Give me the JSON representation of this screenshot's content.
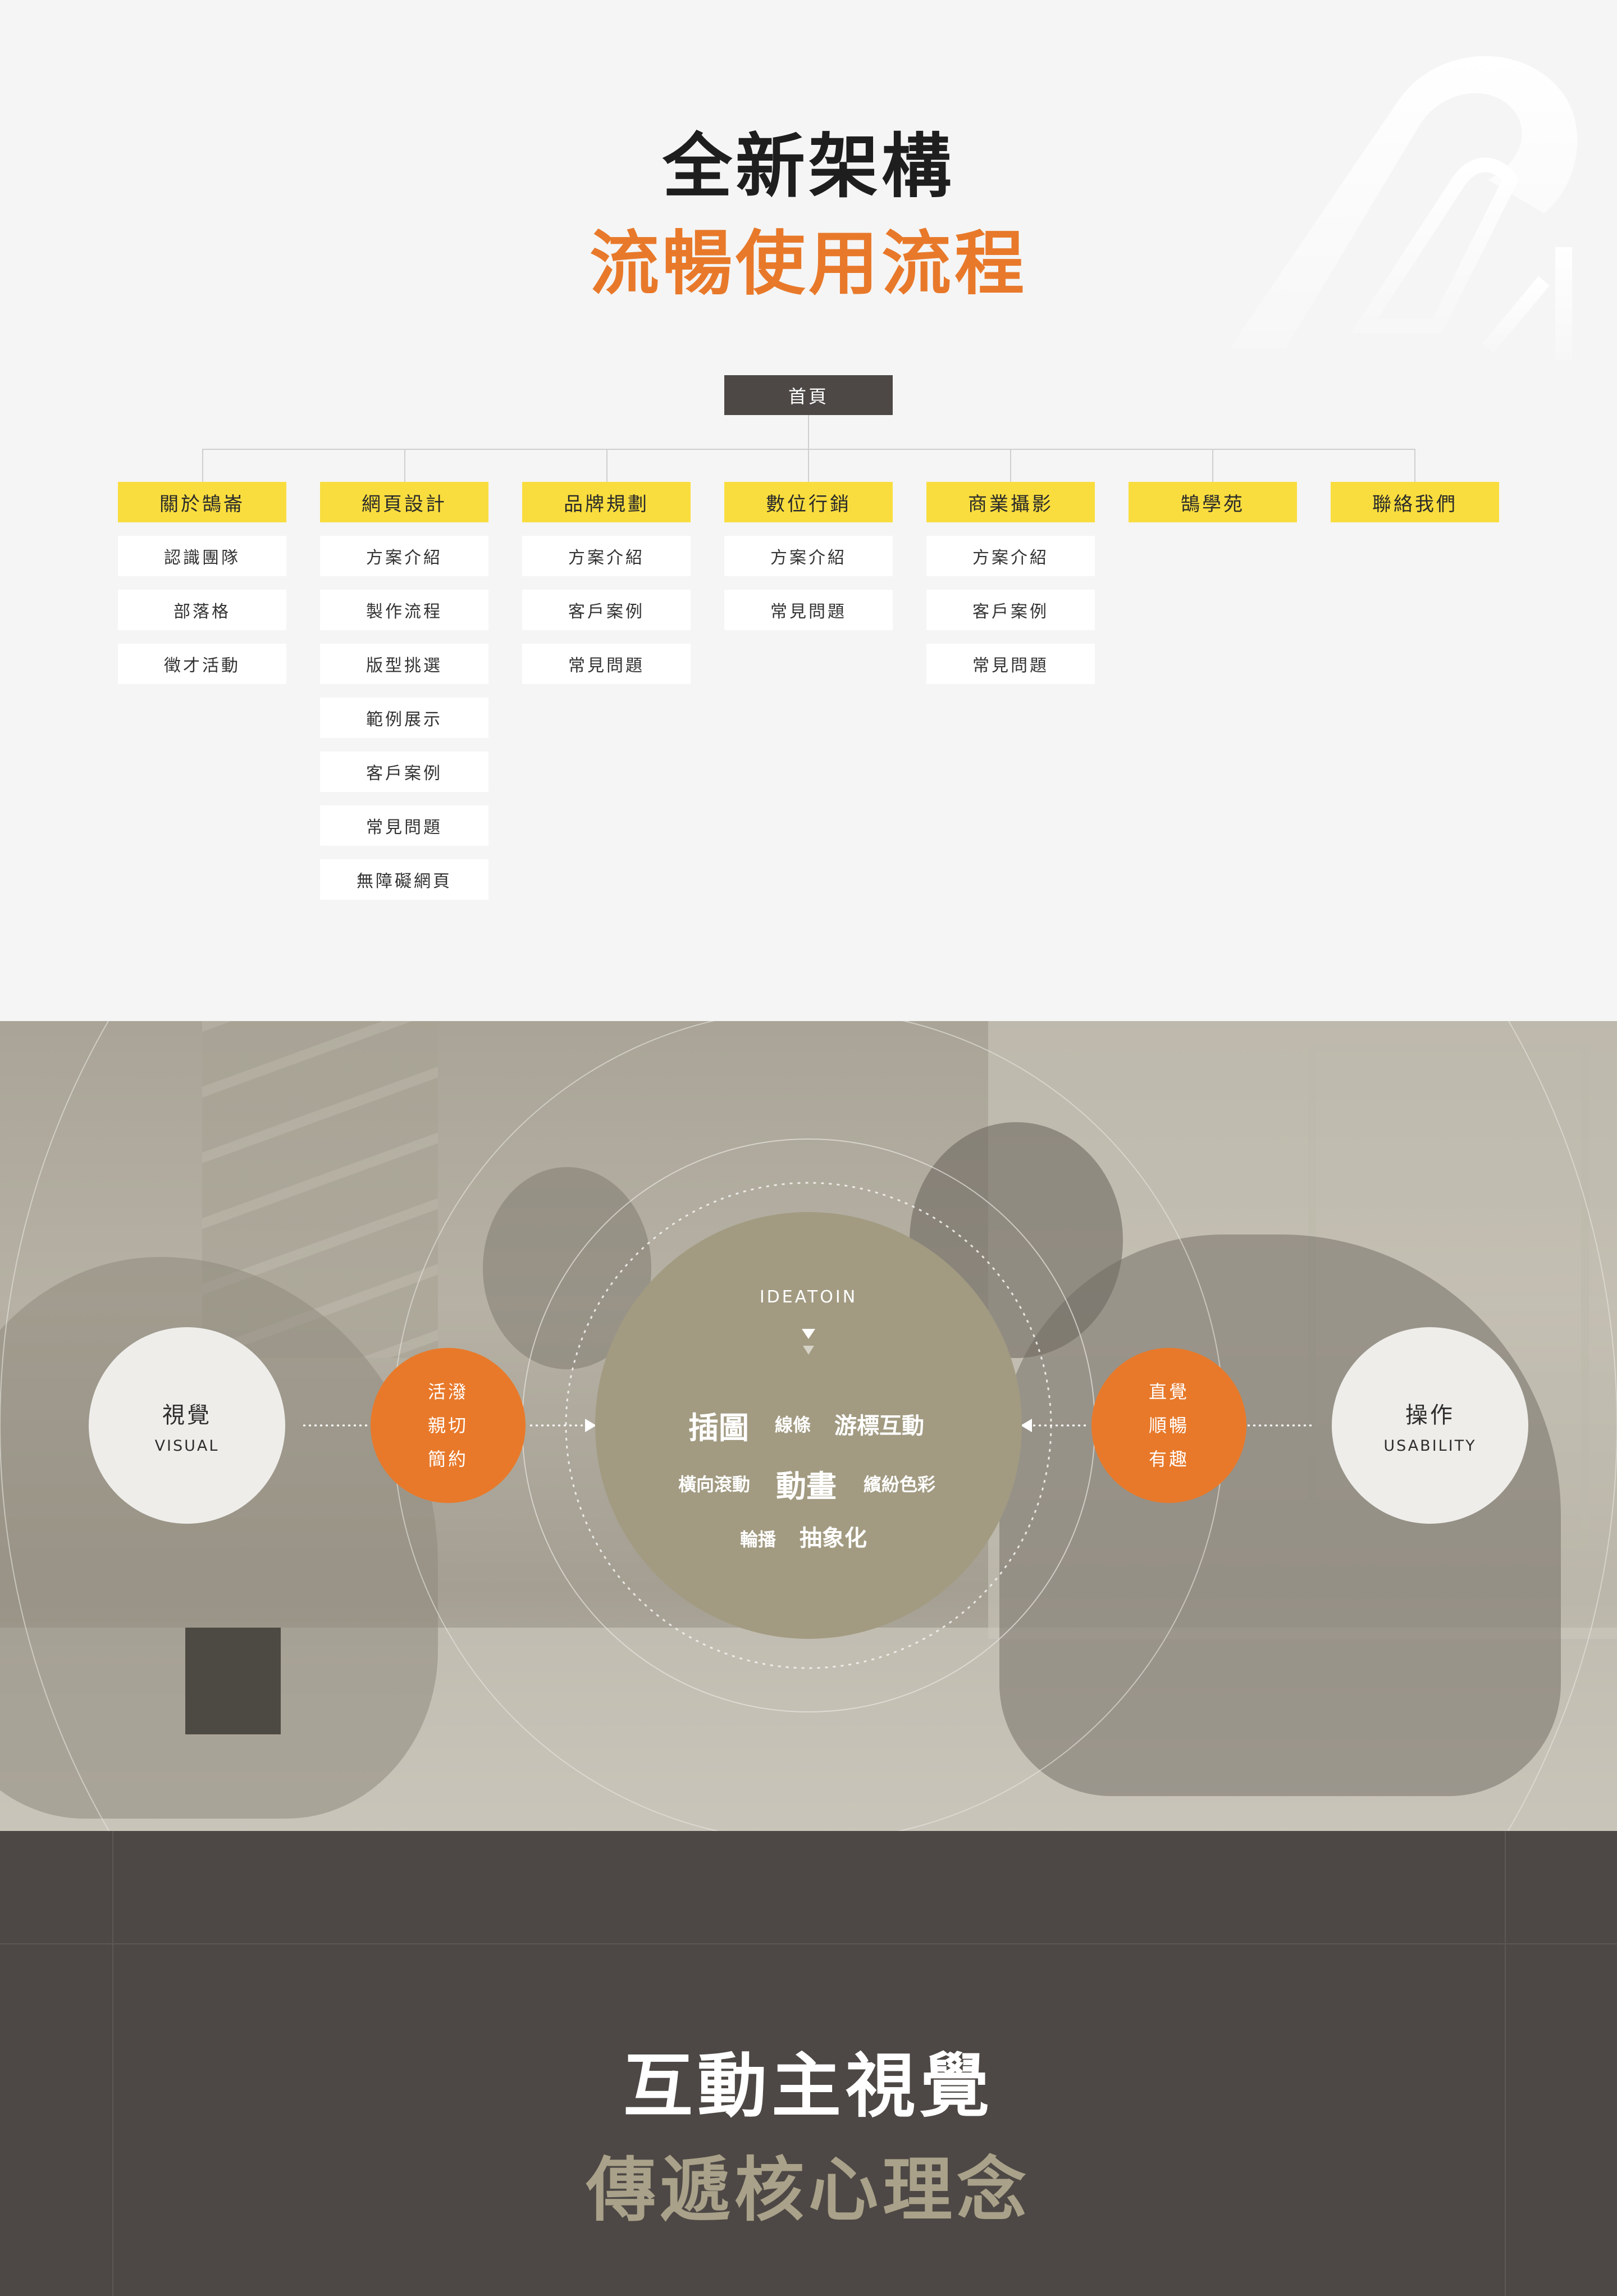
{
  "sitemap": {
    "title_line1": "全新架構",
    "title_line2": "流暢使用流程",
    "home": "首頁",
    "columns": [
      {
        "label": "關於鵠崙",
        "items": [
          "認識團隊",
          "部落格",
          "徵才活動"
        ]
      },
      {
        "label": "網頁設計",
        "items": [
          "方案介紹",
          "製作流程",
          "版型挑選",
          "範例展示",
          "客戶案例",
          "常見問題",
          "無障礙網頁"
        ]
      },
      {
        "label": "品牌規劃",
        "items": [
          "方案介紹",
          "客戶案例",
          "常見問題"
        ]
      },
      {
        "label": "數位行銷",
        "items": [
          "方案介紹",
          "常見問題"
        ]
      },
      {
        "label": "商業攝影",
        "items": [
          "方案介紹",
          "客戶案例",
          "常見問題"
        ]
      },
      {
        "label": "鵠學苑",
        "items": []
      },
      {
        "label": "聯絡我們",
        "items": []
      }
    ]
  },
  "diagram": {
    "left": {
      "zh": "視覺",
      "en": "VISUAL",
      "traits": [
        "活潑",
        "親切",
        "簡約"
      ]
    },
    "right": {
      "zh": "操作",
      "en": "USABILITY",
      "traits": [
        "直覺",
        "順暢",
        "有趣"
      ]
    },
    "center": {
      "title": "IDEATOIN",
      "keywords": [
        "插圖",
        "線條",
        "游標互動",
        "橫向滾動",
        "動畫",
        "繽紛色彩",
        "輪播",
        "抽象化"
      ]
    }
  },
  "interaction": {
    "title_line1": "互動主視覺",
    "title_line2": "傳遞核心理念"
  },
  "colors": {
    "accent_orange": "#e8792a",
    "accent_yellow": "#f9dd3e",
    "dark": "#4d4845",
    "tan": "#a9a189",
    "center_circle": "#a29b82"
  }
}
